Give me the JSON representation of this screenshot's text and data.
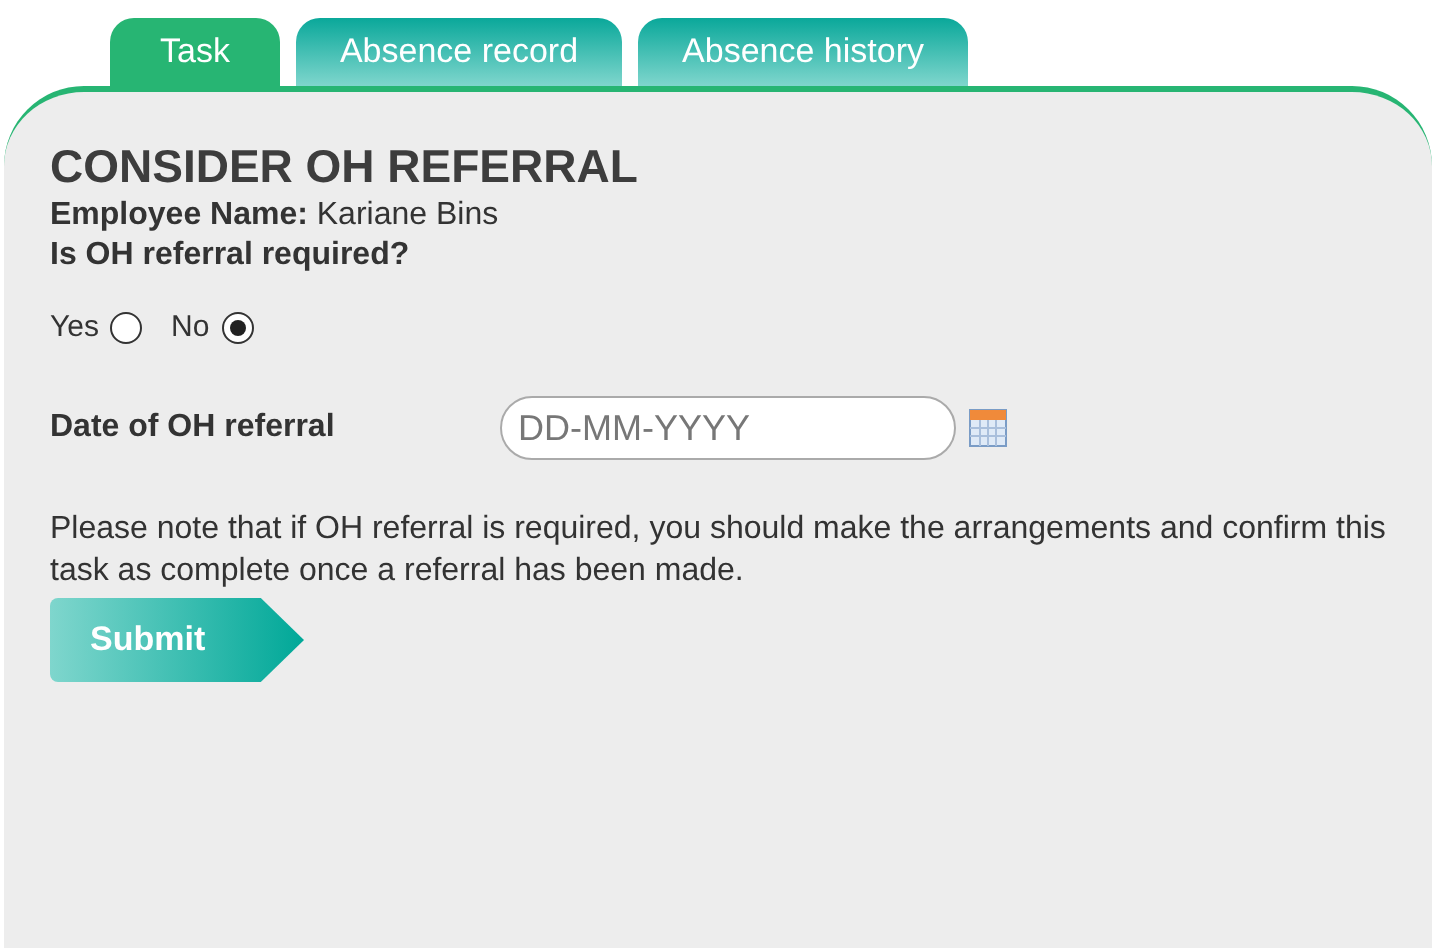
{
  "tabs": [
    {
      "label": "Task",
      "selected": true
    },
    {
      "label": "Absence record",
      "selected": false
    },
    {
      "label": "Absence history",
      "selected": false
    }
  ],
  "form": {
    "title": "CONSIDER OH REFERRAL",
    "employee": "**Employee Name:** Kariane Bins",
    "question": "Is OH referral required?",
    "options": [
      {
        "label": "Yes",
        "selected": false
      },
      {
        "label": "No",
        "selected": true
      }
    ],
    "date_label": "Date of OH referral",
    "date_placeholder": "DD-MM-YYYY",
    "note": "Please note that if OH referral is required, you should make the arrangements and confirm this task as complete once a referral has been made.",
    "submit": "Submit"
  }
}
